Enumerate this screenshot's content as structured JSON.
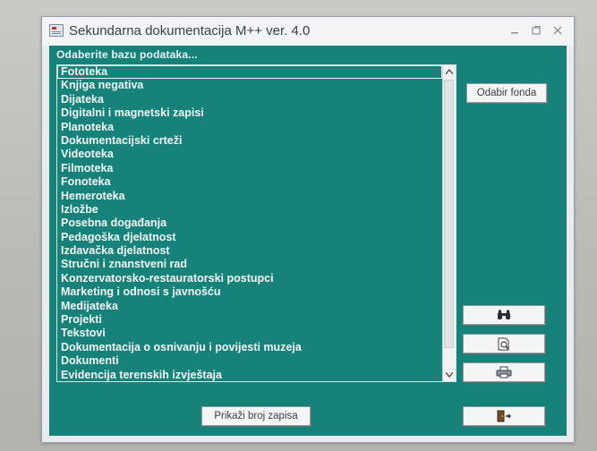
{
  "window": {
    "title": "Sekundarna dokumentacija M++ ver. 4.0"
  },
  "form": {
    "prompt": "Odaberite bazu podataka...",
    "list_items": [
      "Fototeka",
      "Knjiga negativa",
      "Dijateka",
      "Digitalni i magnetski zapisi",
      "Planoteka",
      "Dokumentacijski crteži",
      "Videoteka",
      "Filmoteka",
      "Fonoteka",
      "Hemeroteka",
      "Izložbe",
      "Posebna događanja",
      "Pedagoška djelatnost",
      "Izdavačka djelatnost",
      "Stručni i znanstveni rad",
      "Konzervatorsko-restauratorski postupci",
      "Marketing i odnosi s javnošću",
      "Medijateka",
      "Projekti",
      "Tekstovi",
      "Dokumentacija o osnivanju i povijesti muzeja",
      "Dokumenti",
      "Evidencija terenskih izvještaja"
    ],
    "selected_index": 0,
    "buttons": {
      "odabir_fonda": "Odabir fonda",
      "prikazi_broj_zapisa": "Prikaži broj zapisa"
    },
    "icons": {
      "find": "binoculars-icon",
      "preview": "print-preview-icon",
      "print": "printer-icon",
      "exit": "exit-door-icon"
    }
  },
  "colors": {
    "form_background": "#17827a",
    "list_text": "#f3f8f7",
    "window_chrome": "#f2f4f6"
  }
}
